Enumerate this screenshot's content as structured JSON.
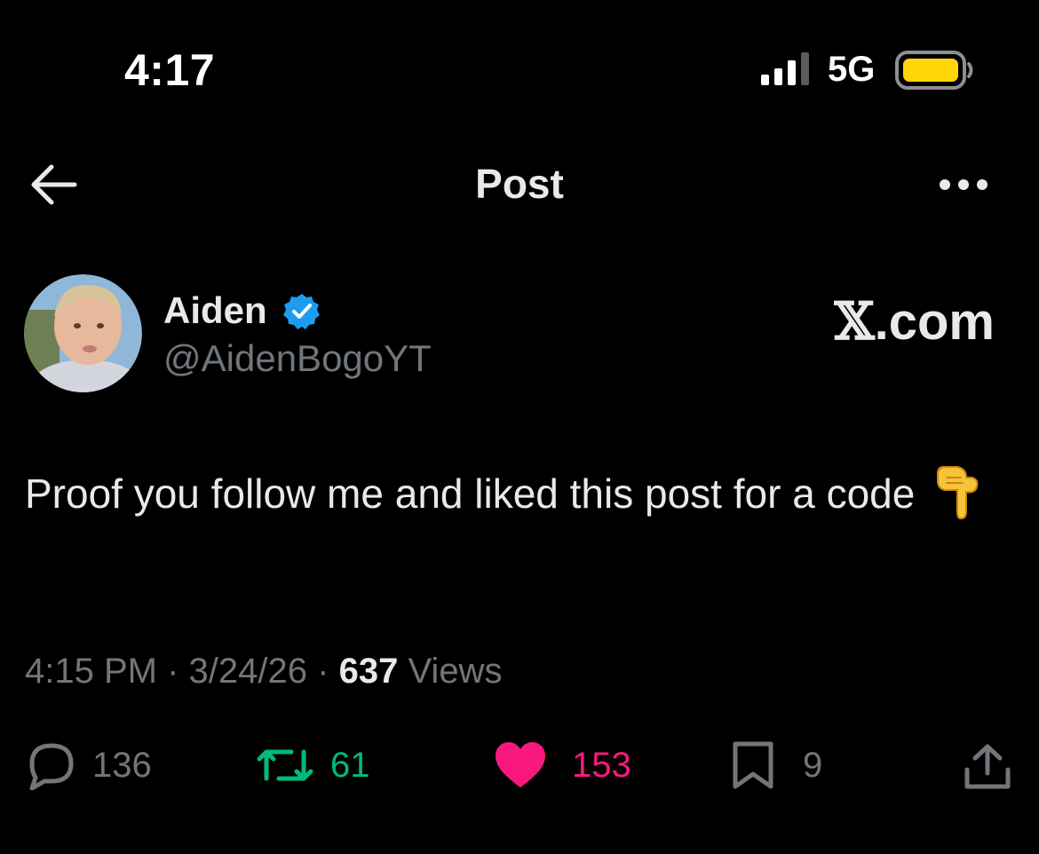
{
  "status_bar": {
    "time": "4:17",
    "network": "5G",
    "signal_icon": "cellular-signal-icon",
    "battery_icon": "battery-icon",
    "battery_color": "#ffd60a"
  },
  "header": {
    "title": "Post",
    "back_icon": "arrow-left-icon",
    "more_icon": "more-dots-icon"
  },
  "author": {
    "name": "Aiden",
    "handle": "@AidenBogoYT",
    "verified_icon": "verified-badge-icon",
    "verified_color": "#1d9bf0"
  },
  "site_label": {
    "x_glyph": "𝕏",
    "suffix": ".com"
  },
  "post": {
    "text": "Proof you follow me and liked this post for a code",
    "emoji_icon": "pointing-down-emoji-icon"
  },
  "meta": {
    "time": "4:15 PM",
    "sep1": "·",
    "date": "3/24/26",
    "sep2": "·",
    "views_count": "637",
    "views_label": "Views"
  },
  "actions": {
    "replies": "136",
    "reposts": "61",
    "likes": "153",
    "bookmarks": "9",
    "reply_icon": "reply-bubble-icon",
    "repost_icon": "repost-icon",
    "like_icon": "heart-icon",
    "bookmark_icon": "bookmark-icon",
    "share_icon": "share-upload-icon",
    "repost_color": "#00ba7c",
    "like_color": "#f91880",
    "muted_color": "#71767b"
  }
}
